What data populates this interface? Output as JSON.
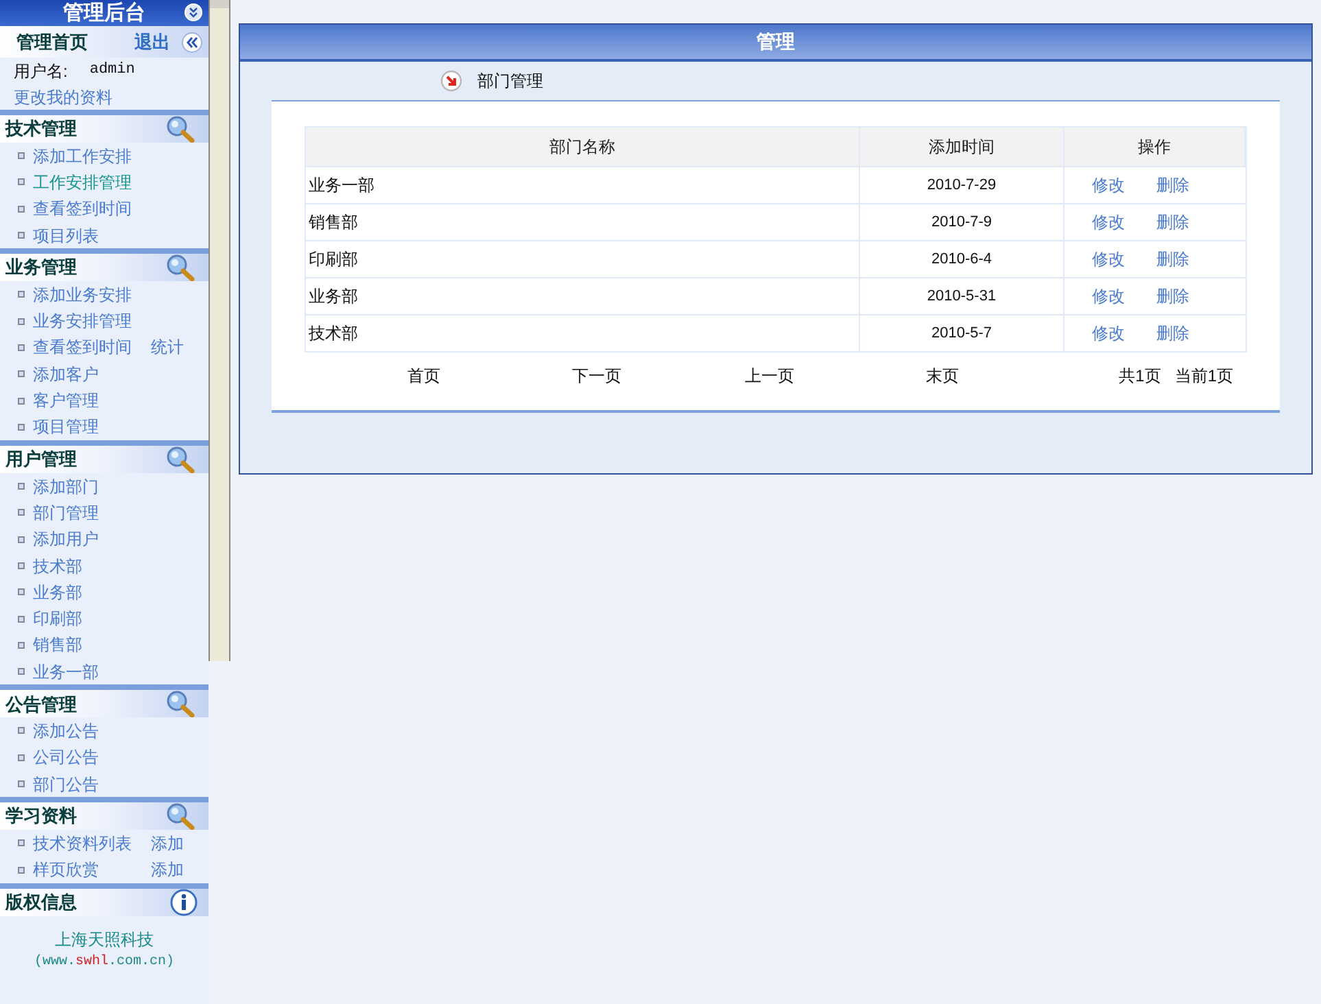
{
  "sidebar": {
    "title": "管理后台",
    "home": {
      "label": "管理首页",
      "logout": "退出"
    },
    "user": {
      "label": "用户名:",
      "value": "admin"
    },
    "profile_link": "更改我的资料",
    "sections": [
      {
        "title": "技术管理",
        "kind": "search",
        "items": [
          {
            "label": "添加工作安排",
            "selected": false
          },
          {
            "label": "工作安排管理",
            "selected": true
          },
          {
            "label": "查看签到时间",
            "selected": false
          },
          {
            "label": "项目列表",
            "selected": false
          }
        ]
      },
      {
        "title": "业务管理",
        "kind": "search",
        "items": [
          {
            "label": "添加业务安排",
            "selected": false
          },
          {
            "label": "业务安排管理",
            "selected": false
          },
          {
            "label": "查看签到时间",
            "selected": false,
            "extra": "统计"
          },
          {
            "label": "添加客户",
            "selected": false
          },
          {
            "label": "客户管理",
            "selected": false
          },
          {
            "label": "项目管理",
            "selected": false
          }
        ]
      },
      {
        "title": "用户管理",
        "kind": "search",
        "items": [
          {
            "label": "添加部门",
            "selected": false
          },
          {
            "label": "部门管理",
            "selected": false
          },
          {
            "label": "添加用户",
            "selected": false
          },
          {
            "label": "技术部",
            "selected": false
          },
          {
            "label": "业务部",
            "selected": false
          },
          {
            "label": "印刷部",
            "selected": false
          },
          {
            "label": "销售部",
            "selected": false
          },
          {
            "label": "业务一部",
            "selected": false
          }
        ]
      },
      {
        "title": "公告管理",
        "kind": "search",
        "items": [
          {
            "label": "添加公告",
            "selected": false
          },
          {
            "label": "公司公告",
            "selected": false
          },
          {
            "label": "部门公告",
            "selected": false
          }
        ]
      },
      {
        "title": "学习资料",
        "kind": "search",
        "items": [
          {
            "label": "技术资料列表",
            "selected": false,
            "extra": "添加"
          },
          {
            "label": "样页欣赏",
            "selected": false,
            "extra": "添加"
          }
        ]
      },
      {
        "title": "版权信息",
        "kind": "info",
        "company": "上海天照科技",
        "url_parts": [
          {
            "text": "(www.",
            "color": "#1a8a8a"
          },
          {
            "text": "swhl",
            "color": "#d42020"
          },
          {
            "text": ".com.cn)",
            "color": "#1a8a8a"
          }
        ]
      }
    ]
  },
  "panel": {
    "title": "管理",
    "subtitle": "部门管理",
    "table": {
      "columns": [
        "部门名称",
        "添加时间",
        "操作"
      ],
      "rows": [
        {
          "name": "业务一部",
          "date": "2010-7-29",
          "actions": [
            "修改",
            "删除"
          ]
        },
        {
          "name": "销售部",
          "date": "2010-7-9",
          "actions": [
            "修改",
            "删除"
          ]
        },
        {
          "name": "印刷部",
          "date": "2010-6-4",
          "actions": [
            "修改",
            "删除"
          ]
        },
        {
          "name": "业务部",
          "date": "2010-5-31",
          "actions": [
            "修改",
            "删除"
          ]
        },
        {
          "name": "技术部",
          "date": "2010-5-7",
          "actions": [
            "修改",
            "删除"
          ]
        }
      ]
    },
    "pagination": {
      "links": [
        "首页",
        "下一页",
        "上一页",
        "末页"
      ],
      "total": "共1页",
      "current": "当前1页"
    }
  }
}
